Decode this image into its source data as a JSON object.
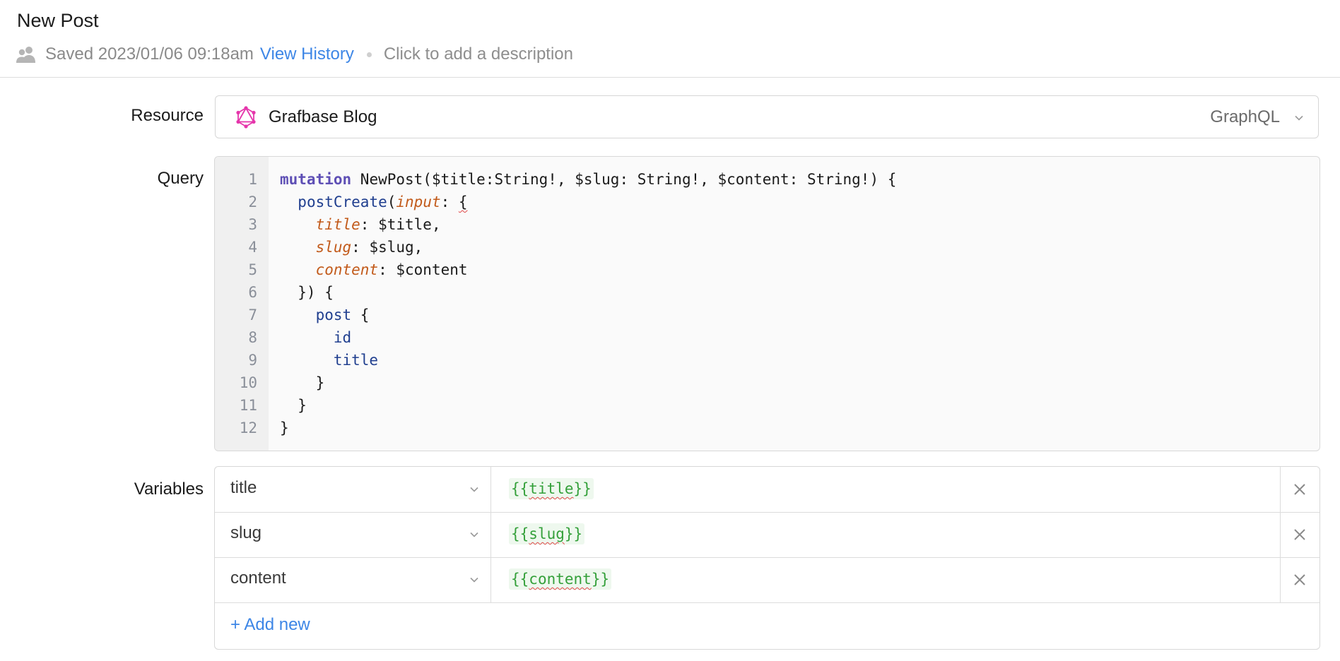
{
  "header": {
    "title": "New Post",
    "saved_text": "Saved 2023/01/06 09:18am",
    "history_link": "View History",
    "description_placeholder": "Click to add a description"
  },
  "resource": {
    "label": "Resource",
    "name": "Grafbase Blog",
    "type": "GraphQL"
  },
  "query": {
    "label": "Query",
    "line_numbers": [
      "1",
      "2",
      "3",
      "4",
      "5",
      "6",
      "7",
      "8",
      "9",
      "10",
      "11",
      "12"
    ]
  },
  "variables": {
    "label": "Variables",
    "rows": [
      {
        "key": "title",
        "value_open": "{{",
        "value_name": "title",
        "value_close": "}}"
      },
      {
        "key": "slug",
        "value_open": "{{",
        "value_name": "slug",
        "value_close": "}}"
      },
      {
        "key": "content",
        "value_open": "{{",
        "value_name": "content",
        "value_close": "}}"
      }
    ],
    "add_label": "+ Add new"
  },
  "colors": {
    "link": "#3d86e6",
    "keyword": "#5e4fb5",
    "field": "#203f8f",
    "argument": "#c25a1a",
    "template": "#34a03a",
    "graphql_icon": "#e535ab"
  },
  "icons": [
    "users-icon",
    "graphql-icon",
    "chevron-down-icon",
    "close-icon"
  ]
}
